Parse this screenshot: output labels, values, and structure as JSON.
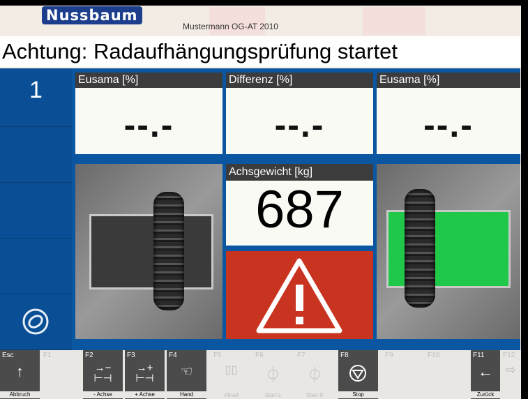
{
  "header": {
    "brand": "Nussbaum",
    "company": "Mustermann OG-AT 2010",
    "title": "Achtung: Radaufhängungsprüfung startet"
  },
  "side": {
    "axle_number": "1"
  },
  "left_eusama": {
    "label": "Eusama [%]",
    "value": "--.-"
  },
  "difference": {
    "label": "Differenz [%]",
    "value": "--.-"
  },
  "right_eusama": {
    "label": "Eusama [%]",
    "value": "--.-"
  },
  "axle_weight": {
    "label": "Achsgewicht [kg]",
    "value": "687"
  },
  "colors": {
    "panel_blue": "#0b56a0",
    "warning_red": "#c8341f",
    "plate_green": "#20c84a"
  },
  "function_keys": [
    {
      "key": "Esc",
      "label": "Abbruch",
      "icon": "arrow-up-icon",
      "enabled": true
    },
    {
      "key": "F1",
      "label": "",
      "icon": "",
      "enabled": false
    },
    {
      "key": "F2",
      "label": "- Achse",
      "icon": "axle-minus-icon",
      "enabled": true
    },
    {
      "key": "F3",
      "label": "+ Achse",
      "icon": "axle-plus-icon",
      "enabled": true
    },
    {
      "key": "F4",
      "label": "Hand",
      "icon": "hand-icon",
      "enabled": true
    },
    {
      "key": "F5",
      "label": "Allrad",
      "icon": "allwheel-icon",
      "enabled": false
    },
    {
      "key": "F6",
      "label": "Start L",
      "icon": "start-left-icon",
      "enabled": false
    },
    {
      "key": "F7",
      "label": "Start R",
      "icon": "start-right-icon",
      "enabled": false
    },
    {
      "key": "F8",
      "label": "Stop",
      "icon": "stop-icon",
      "enabled": true
    },
    {
      "key": "F9",
      "label": "",
      "icon": "",
      "enabled": false
    },
    {
      "key": "F10",
      "label": "",
      "icon": "",
      "enabled": false
    },
    {
      "key": "F11",
      "label": "Zurück",
      "icon": "arrow-left-icon",
      "enabled": true
    },
    {
      "key": "F12",
      "label": "",
      "icon": "arrow-right-icon",
      "enabled": false
    }
  ]
}
